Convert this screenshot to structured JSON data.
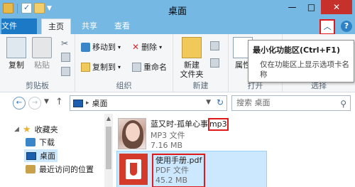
{
  "window": {
    "title": "桌面",
    "minimize": "—",
    "maximize": "□",
    "close": "✕"
  },
  "tabs": {
    "file": "文件",
    "home": "主页",
    "share": "共享",
    "view": "查看"
  },
  "ribbon": {
    "clipboard": {
      "copy": "复制",
      "paste": "粘贴",
      "label": "剪贴板"
    },
    "organize": {
      "move_to": "移动到",
      "copy_to": "复制到",
      "delete": "删除",
      "rename": "重命名",
      "label": "组织"
    },
    "new": {
      "new_folder_line1": "新建",
      "new_folder_line2": "文件夹",
      "label": "新建"
    },
    "open": {
      "properties": "属性",
      "label": "打开"
    },
    "select": {
      "label": "选择"
    }
  },
  "tooltip": {
    "title": "最小化功能区(Ctrl+F1)",
    "body": "仅在功能区上显示选项卡名称"
  },
  "address": {
    "path": "桌面",
    "search_placeholder": "搜索 桌面"
  },
  "nav": {
    "favorites": "收藏夹",
    "downloads": "下载",
    "desktop": "桌面",
    "recent": "最近访问的位置"
  },
  "files": [
    {
      "name_prefix": "蓝又时-孤单心事",
      "name_ext": "mp3",
      "type": "MP3 文件",
      "size": "7.16 MB"
    },
    {
      "name": "使用手册.pdf",
      "type": "PDF 文件",
      "size": "45.2 MB"
    }
  ],
  "colors": {
    "titlebar": "#76b8e4",
    "file_tab": "#1b79c6",
    "close_button": "#c7312b",
    "highlight_red": "#e01a1a",
    "selection": "#cce8ff"
  }
}
